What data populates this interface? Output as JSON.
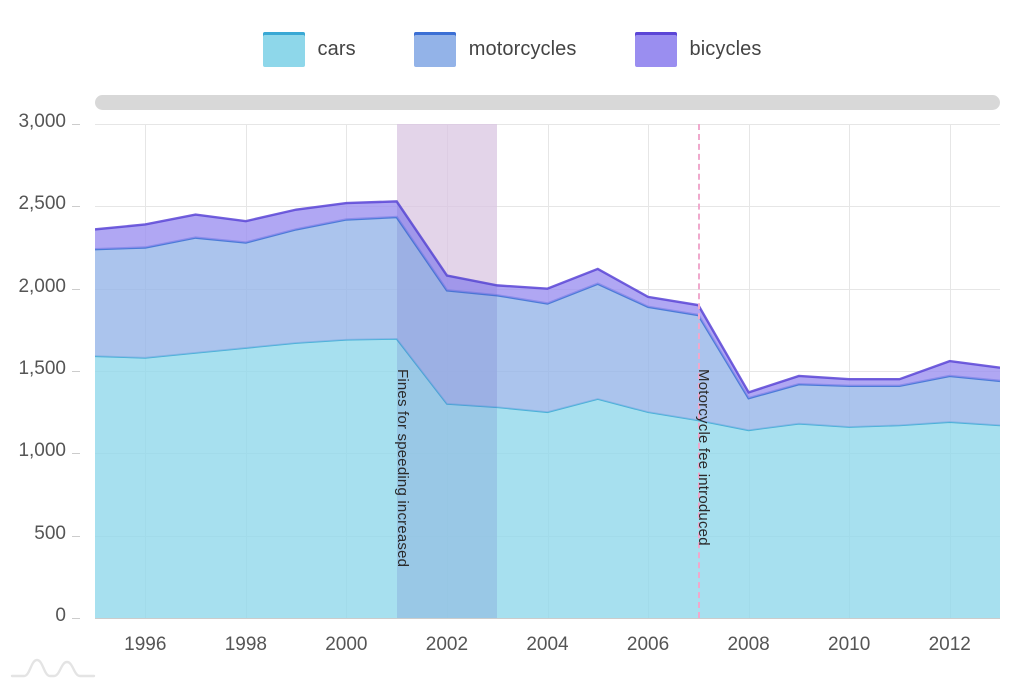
{
  "legend": {
    "items": [
      {
        "label": "cars",
        "color": "#8ed7ea",
        "border": "#39a8d4"
      },
      {
        "label": "motorcycles",
        "color": "#93b3e8",
        "border": "#3b6fd4"
      },
      {
        "label": "bicycles",
        "color": "#9a8ef0",
        "border": "#5b45d6"
      }
    ]
  },
  "navigator": {
    "name": "range-scrollbar"
  },
  "annotations": [
    {
      "text": "Fines for speeding increased",
      "year": 2001
    },
    {
      "text": "Motorcycle fee introduced",
      "year": 2007
    }
  ],
  "plot_band": {
    "from_year": 2001,
    "to_year": 2003,
    "color": "#fbdfe9"
  },
  "plot_line": {
    "year": 2007,
    "color": "#f0a9cd",
    "dash": "dashed"
  },
  "selection": {
    "from_year": 2001,
    "to_year": 2003
  },
  "chart_data": {
    "type": "area",
    "stacked": true,
    "title": "",
    "xlabel": "",
    "ylabel": "",
    "xlim": [
      1995,
      2013
    ],
    "ylim": [
      0,
      3000
    ],
    "ytick_values": [
      0,
      500,
      1000,
      1500,
      2000,
      2500,
      3000
    ],
    "ytick_labels": [
      "0",
      "500",
      "1,000",
      "1,500",
      "2,000",
      "2,500",
      "3,000"
    ],
    "xtick_values": [
      1996,
      1998,
      2000,
      2002,
      2004,
      2006,
      2008,
      2010,
      2012
    ],
    "xtick_labels": [
      "1996",
      "1998",
      "2000",
      "2002",
      "2004",
      "2006",
      "2008",
      "2010",
      "2012"
    ],
    "grid": true,
    "legend_position": "top",
    "x": [
      1995,
      1996,
      1997,
      1998,
      1999,
      2000,
      2001,
      2002,
      2003,
      2004,
      2005,
      2006,
      2007,
      2008,
      2009,
      2010,
      2011,
      2012,
      2013
    ],
    "series": [
      {
        "name": "cars",
        "color": "#8ed7ea",
        "line_color": "#39a8d4",
        "values": [
          1590,
          1580,
          1610,
          1640,
          1670,
          1690,
          1695,
          1300,
          1280,
          1250,
          1330,
          1250,
          1200,
          1140,
          1180,
          1160,
          1170,
          1190,
          1170
        ]
      },
      {
        "name": "motorcycles",
        "color": "#93b3e8",
        "line_color": "#3b6fd4",
        "values": [
          650,
          670,
          700,
          640,
          690,
          730,
          740,
          690,
          680,
          660,
          700,
          640,
          640,
          195,
          240,
          250,
          240,
          280,
          270
        ]
      },
      {
        "name": "bicycles",
        "color": "#9a8ef0",
        "line_color": "#5b45d6",
        "values": [
          120,
          140,
          140,
          130,
          120,
          100,
          95,
          90,
          60,
          90,
          90,
          60,
          60,
          35,
          50,
          40,
          40,
          90,
          80
        ]
      }
    ],
    "totals": [
      2360,
      2390,
      2450,
      2410,
      2480,
      2520,
      2530,
      2080,
      2020,
      2000,
      2120,
      1950,
      1900,
      1370,
      1470,
      1450,
      1450,
      1560,
      1520
    ]
  }
}
